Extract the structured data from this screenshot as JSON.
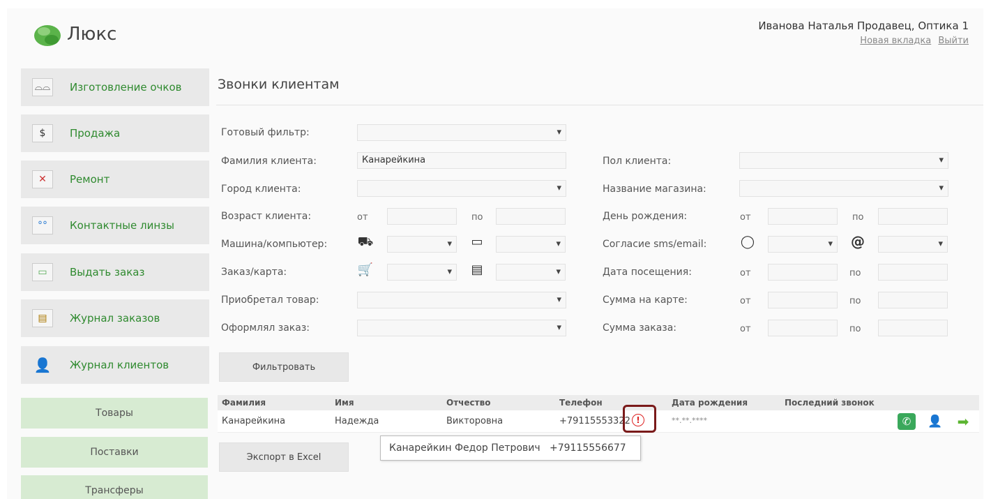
{
  "header": {
    "app_title": "Люкс",
    "user": "Иванова Наталья Продавец, Оптика 1",
    "links": [
      "Новая вкладка",
      "Выйти"
    ]
  },
  "sidebar": {
    "items": [
      {
        "label": "Изготовление очков",
        "icon": "glasses-icon"
      },
      {
        "label": "Продажа",
        "icon": "sale-icon"
      },
      {
        "label": "Ремонт",
        "icon": "repair-icon"
      },
      {
        "label": "Контактные линзы",
        "icon": "lenses-icon"
      },
      {
        "label": "Выдать заказ",
        "icon": "issue-order-icon"
      },
      {
        "label": "Журнал заказов",
        "icon": "orders-journal-icon"
      },
      {
        "label": "Журнал клиентов",
        "icon": "clients-journal-icon"
      }
    ],
    "secondary": [
      "Товары",
      "Поставки",
      "Трансферы"
    ]
  },
  "main": {
    "title": "Звонки клиентам",
    "filters": {
      "ready_filter": {
        "label": "Готовый фильтр:",
        "value": ""
      },
      "last_name": {
        "label": "Фамилия клиента:",
        "value": "Канарейкина"
      },
      "city": {
        "label": "Город клиента:",
        "value": ""
      },
      "age": {
        "label": "Возраст клиента:",
        "from": "от",
        "to": "по"
      },
      "car_pc": {
        "label": "Машина/компьютер:"
      },
      "order_card": {
        "label": "Заказ/карта:"
      },
      "bought": {
        "label": "Приобретал товар:"
      },
      "ordered": {
        "label": "Оформлял заказ:"
      },
      "gender": {
        "label": "Пол клиента:"
      },
      "store": {
        "label": "Название магазина:"
      },
      "birthday": {
        "label": "День рождения:",
        "from": "от",
        "to": "по"
      },
      "consent": {
        "label": "Согласие sms/email:"
      },
      "visit_date": {
        "label": "Дата посещения:",
        "from": "от",
        "to": "по"
      },
      "card_sum": {
        "label": "Сумма на карте:",
        "from": "от",
        "to": "по"
      },
      "order_sum": {
        "label": "Сумма заказа:",
        "from": "от",
        "to": "по"
      }
    },
    "filter_button": "Фильтровать",
    "export_button": "Экспорт в Excel",
    "table": {
      "columns": [
        "Фамилия",
        "Имя",
        "Отчество",
        "Телефон",
        "Дата рождения",
        "Последний звонок"
      ],
      "rows": [
        {
          "last": "Канарейкина",
          "first": "Надежда",
          "middle": "Викторовна",
          "phone": "+79115553322",
          "birth": "**.**.****",
          "last_call": ""
        }
      ]
    },
    "tooltip": {
      "name": "Канарейкин Федор Петрович",
      "phone": "+79115556677"
    }
  }
}
